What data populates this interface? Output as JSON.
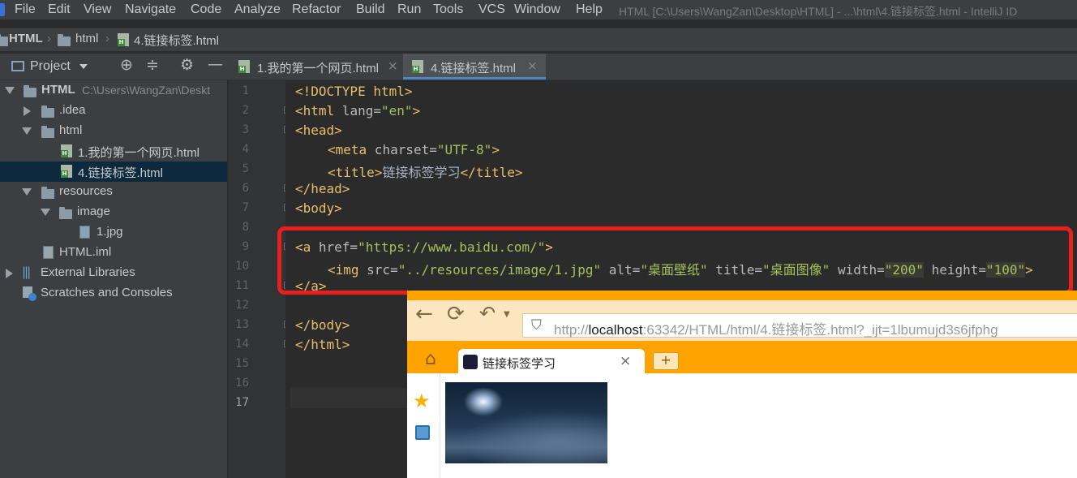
{
  "menu": {
    "items": [
      "File",
      "Edit",
      "View",
      "Navigate",
      "Code",
      "Analyze",
      "Refactor",
      "Build",
      "Run",
      "Tools",
      "VCS",
      "Window",
      "Help"
    ],
    "window_title": "HTML [C:\\Users\\WangZan\\Desktop\\HTML] - ...\\html\\4.链接标签.html - IntelliJ ID"
  },
  "breadcrumb": [
    "HTML",
    "html",
    "4.链接标签.html"
  ],
  "project_panel": {
    "title": "Project"
  },
  "tree": [
    {
      "label": "HTML",
      "path": "C:\\Users\\WangZan\\Deskt"
    },
    {
      "label": ".idea"
    },
    {
      "label": "html"
    },
    {
      "label": "1.我的第一个网页.html"
    },
    {
      "label": "4.链接标签.html"
    },
    {
      "label": "resources"
    },
    {
      "label": "image"
    },
    {
      "label": "1.jpg"
    },
    {
      "label": "HTML.iml"
    },
    {
      "label": "External Libraries"
    },
    {
      "label": "Scratches and Consoles"
    }
  ],
  "tabs": [
    {
      "label": "1.我的第一个网页.html",
      "close": "×"
    },
    {
      "label": "4.链接标签.html",
      "close": "×"
    }
  ],
  "line_numbers": [
    "1",
    "2",
    "3",
    "4",
    "5",
    "6",
    "7",
    "8",
    "9",
    "10",
    "11",
    "12",
    "13",
    "14",
    "15",
    "16",
    "17"
  ],
  "code": {
    "l1": "<!DOCTYPE html>",
    "l2_tag": "<html",
    "l2_attr": " lang=",
    "l2_val": "\"en\"",
    "l2_end": ">",
    "l3": "<head>",
    "l4_tag": "<meta",
    "l4_attr": " charset=",
    "l4_val": "\"UTF-8\"",
    "l4_end": ">",
    "l5_open": "<title>",
    "l5_text": "链接标签学习",
    "l5_close": "</title>",
    "l6": "</head>",
    "l7": "<body>",
    "l9_tag": "<a",
    "l9_attr": " href=",
    "l9_val": "\"https://www.baidu.com/\"",
    "l9_end": ">",
    "l10_tag": "<img",
    "l10_a1": " src=",
    "l10_v1": "\"../resources/image/1.jpg\"",
    "l10_a2": " alt=",
    "l10_v2": "\"桌面壁纸\"",
    "l10_a3": " title=",
    "l10_v3": "\"桌面图像\"",
    "l10_a4": " width=",
    "l10_v4": "\"200\"",
    "l10_a5": " height=",
    "l10_v5": "\"100\"",
    "l10_end": ">",
    "l11": "</a>",
    "l13": "</body>",
    "l14": "</html>"
  },
  "browser": {
    "url_prefix": "http://",
    "url_host": "localhost",
    "url_rest": ":63342/HTML/html/4.链接标签.html?_ijt=1lbumujd3s6jfphg",
    "tab_title": "链接标签学习",
    "tab_close": "×",
    "new_tab": "+"
  },
  "colors": {
    "ide_bg": "#2b2b2b",
    "panel_bg": "#3c3f41",
    "tag": "#e8bf6a",
    "string": "#a5c25c",
    "annotation_red": "#ea1f1f",
    "browser_orange": "#ffa300"
  }
}
